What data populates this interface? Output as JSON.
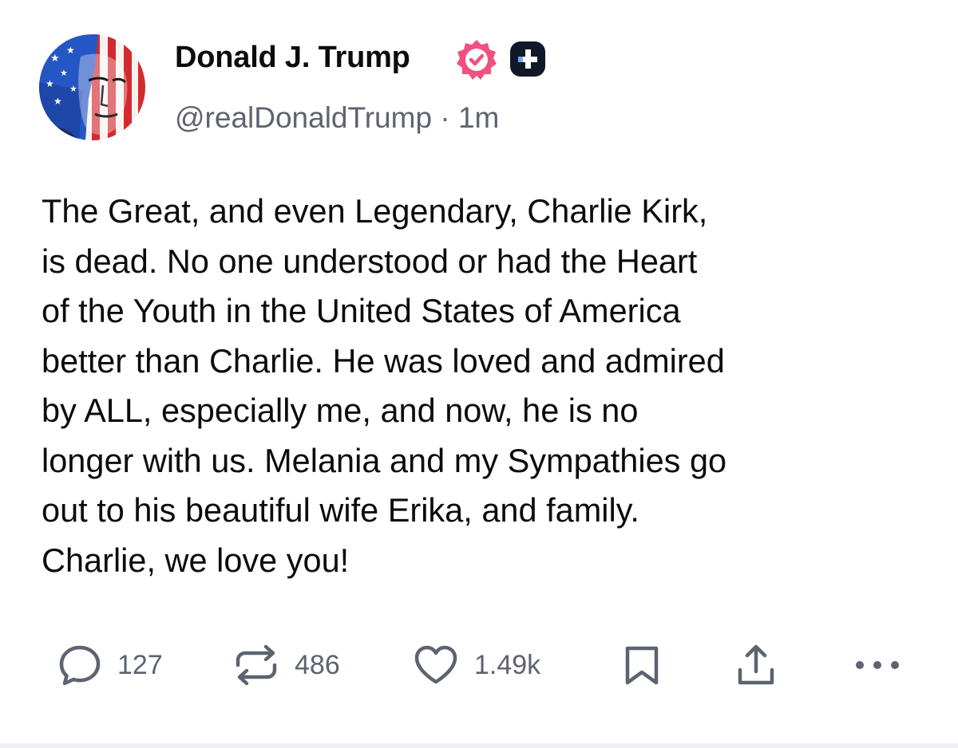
{
  "post": {
    "author": {
      "name": "Donald J. Trump",
      "handle": "@realDonaldTrump",
      "separator": "·",
      "time": "1m",
      "avatar_icon": "flag-portrait-avatar",
      "verified_icon": "verified-check-icon",
      "plus_icon": "plus-badge-icon"
    },
    "body_lines": [
      "The Great, and even Legendary, Charlie Kirk,",
      "is dead. No one understood or had the Heart",
      "of the Youth in the United States of America",
      "better than Charlie. He was loved and admired",
      "by ALL, especially me, and now, he is no",
      "longer with us. Melania and my Sympathies go",
      "out to his beautiful wife Erika, and family.",
      "Charlie, we love you!"
    ],
    "actions": {
      "replies": {
        "count": "127",
        "icon": "reply-bubble-icon"
      },
      "reposts": {
        "count": "486",
        "icon": "repost-arrows-icon"
      },
      "likes": {
        "count": "1.49k",
        "icon": "heart-icon"
      },
      "bookmark": {
        "icon": "bookmark-icon"
      },
      "share": {
        "icon": "share-upload-icon"
      },
      "more": {
        "icon": "more-dots-icon"
      }
    }
  },
  "colors": {
    "text_primary": "#0c0c0c",
    "text_secondary": "#5d6370",
    "verified_badge": "#f0517f",
    "plus_badge": "#111827",
    "background": "#ffffff"
  }
}
